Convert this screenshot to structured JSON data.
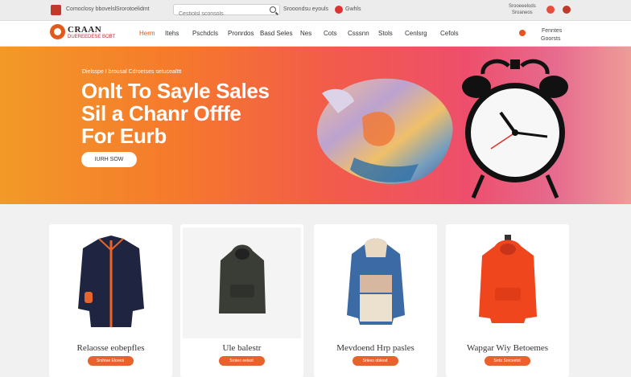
{
  "topbar": {
    "left_text": "Comoclosy bbovelsl",
    "link_text": "Srorotoelidmt",
    "search_placeholder": "Cestiolsl sconsols",
    "mid_text": "Srooondsu eyouls",
    "right_text": "Gwhls",
    "account_line1": "Srooeeelods",
    "account_line2": "Sroaneos"
  },
  "nav": {
    "brand_name": "CRAAN",
    "brand_tag": "DUEREEDESE BOBT",
    "menu": [
      "Herm",
      "Itehs",
      "Pschdcls",
      "Pronrdos",
      "Basd Seles",
      "Nes",
      "Cots",
      "Csssnn",
      "Stols",
      "Cenlsrg",
      "Cefols"
    ],
    "active_index": 0,
    "right_line1": "Fenntes",
    "right_line2": "Goorsts"
  },
  "hero": {
    "top_text": "Dielsspe I brousal Cdroetses setucealttt",
    "line1": "Onlt To Sayle Sales",
    "line2": "Sil a Chanr Offfe",
    "line3": "For Eurb",
    "cta": "IURH SOW"
  },
  "products": [
    {
      "title": "Relaosse eobepfles",
      "button": "Srshtee Eloreoi"
    },
    {
      "title": "Ule balestr",
      "button": "Sroteo eelsot"
    },
    {
      "title": "Mevdoend Hrp pasles",
      "button": "Srleeo obleod"
    },
    {
      "title": "Wapgar Wiy Betoemes",
      "button": "Srrto Sorceetol"
    }
  ],
  "colors": {
    "accent": "#e8521c",
    "hero_start": "#f29a28",
    "hero_end": "#ef9c98"
  }
}
